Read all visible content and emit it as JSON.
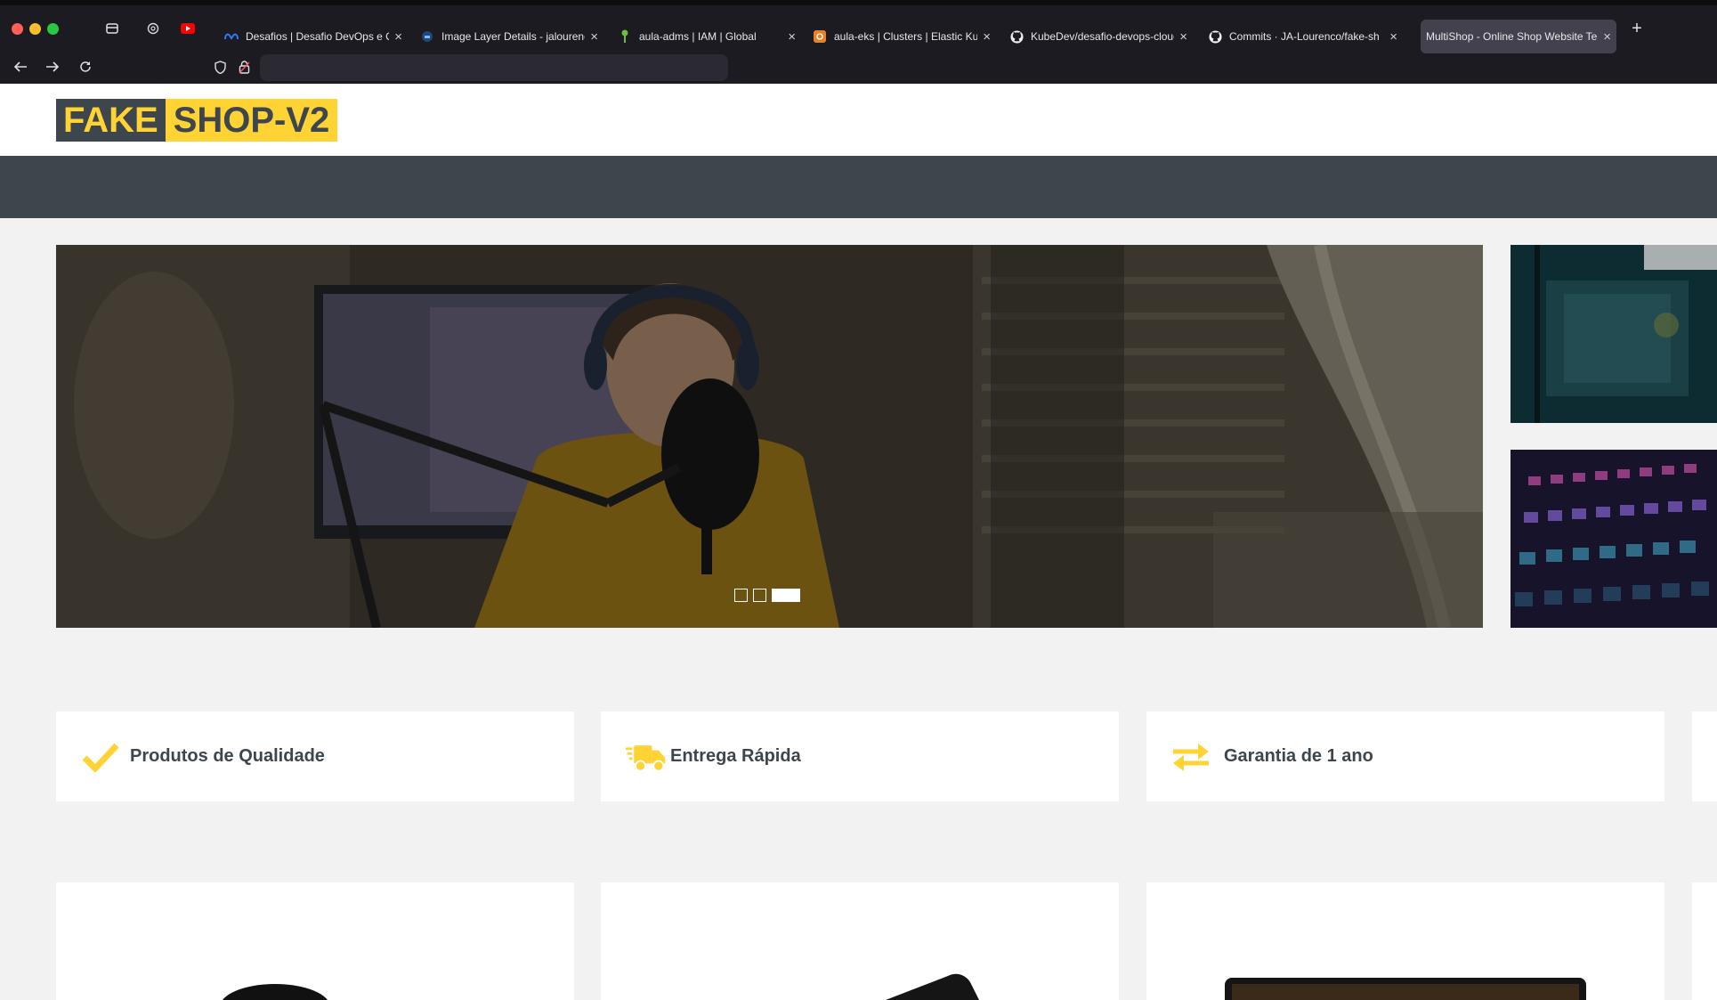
{
  "browser": {
    "tabs": [
      {
        "label": "Desafios | Desafio DevOps e Clo",
        "icon": "meta-icon"
      },
      {
        "label": "Image Layer Details - jalourenco",
        "icon": "docker-icon"
      },
      {
        "label": "aula-adms | IAM | Global",
        "icon": "key-icon"
      },
      {
        "label": "aula-eks | Clusters | Elastic Kube",
        "icon": "aws-icon"
      },
      {
        "label": "KubeDev/desafio-devops-cloud",
        "icon": "github-icon"
      },
      {
        "label": "Commits · JA-Lourenco/fake-sh",
        "icon": "github-icon"
      },
      {
        "label": "MultiShop - Online Shop Website Te",
        "icon": "none",
        "active": true
      }
    ],
    "new_tab": "+",
    "close_glyph": "×",
    "url": ""
  },
  "header": {
    "logo_part1": "FAKE",
    "logo_part2": "SHOP-V2"
  },
  "carousel": {
    "slide_count": 3,
    "active_index": 2
  },
  "features": [
    {
      "icon": "check-icon",
      "label": "Produtos de Qualidade"
    },
    {
      "icon": "shipping-truck-icon",
      "label": "Entrega Rápida"
    },
    {
      "icon": "exchange-arrows-icon",
      "label": "Garantia de 1 ano"
    }
  ],
  "colors": {
    "accent": "#ffd333",
    "dark": "#3d464d",
    "page_bg": "#f2f2f2",
    "chrome_bg": "#1c1b22",
    "active_tab": "#42414d"
  }
}
